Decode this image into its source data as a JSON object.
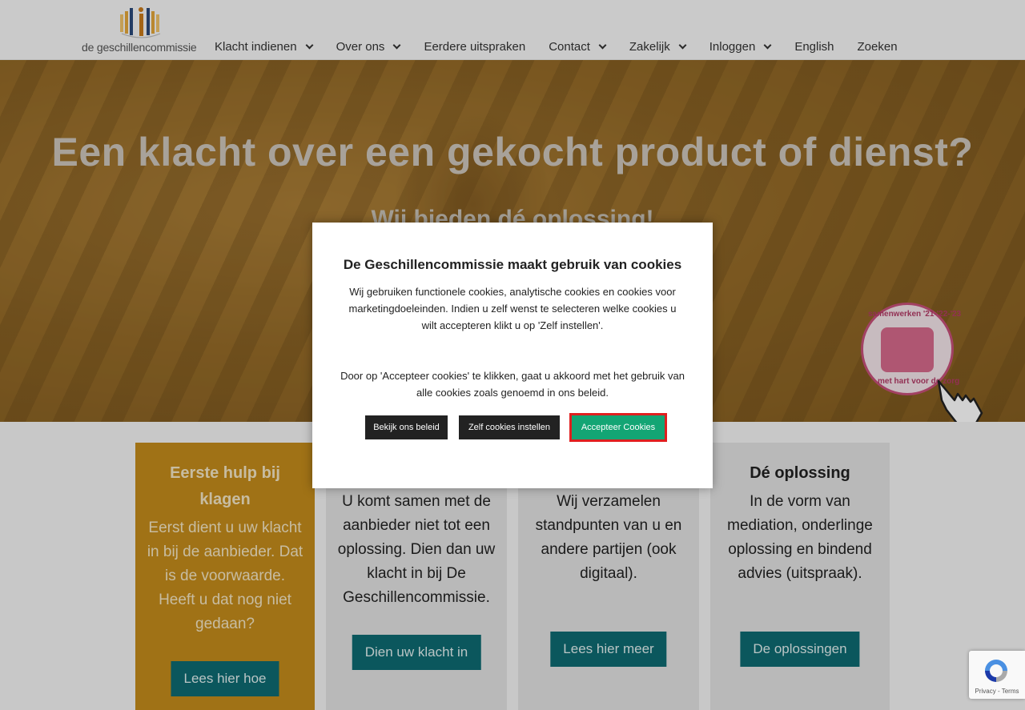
{
  "header": {
    "logo_text": "de geschillencommissie",
    "nav": [
      {
        "label": "Klacht indienen",
        "dropdown": true
      },
      {
        "label": "Over ons",
        "dropdown": true
      },
      {
        "label": "Eerdere uitspraken",
        "dropdown": false
      },
      {
        "label": "Contact",
        "dropdown": true
      },
      {
        "label": "Zakelijk",
        "dropdown": true
      },
      {
        "label": "Inloggen",
        "dropdown": true
      },
      {
        "label": "English",
        "dropdown": false
      },
      {
        "label": "Zoeken",
        "dropdown": false
      }
    ]
  },
  "hero": {
    "title": "Een klacht over een gekocht product of dienst?",
    "subtitle": "Wij bieden dé oplossing!",
    "badge_top": "samenwerken '21-'22-'23",
    "badge_bottom": "met hart voor de zorg"
  },
  "cards": [
    {
      "title": "Eerste hulp bij klagen",
      "text": "Eerst dient u uw klacht in bij de aanbieder. Dat is de voorwaarde. Heeft u dat nog niet gedaan?",
      "button": "Lees hier hoe"
    },
    {
      "title": "",
      "text": "U komt samen met de aanbieder niet tot een oplossing. Dien dan uw klacht in bij De Geschillencommissie.",
      "button": "Dien uw klacht in"
    },
    {
      "title": "",
      "text": "Wij verzamelen standpunten van u en andere partijen (ook digitaal).",
      "button": "Lees hier meer"
    },
    {
      "title": "Dé oplossing",
      "text": "In de vorm van mediation, onderlinge oplossing en bindend advies (uitspraak).",
      "button": "De oplossingen"
    }
  ],
  "cookie_modal": {
    "title": "De Geschillencommissie maakt gebruik van cookies",
    "text1": "Wij gebruiken functionele cookies, analytische cookies en cookies voor marketingdoeleinden. Indien u zelf wenst te selecteren welke cookies u wilt accepteren klikt u op 'Zelf instellen'.",
    "text2": "Door op 'Accepteer cookies' te klikken, gaat u akkoord met het gebruik van alle cookies zoals genoemd in ons beleid.",
    "buttons": {
      "policy": "Bekijk ons beleid",
      "settings": "Zelf cookies instellen",
      "accept": "Accepteer Cookies"
    }
  },
  "recaptcha": {
    "text": "Privacy - Terms"
  },
  "colors": {
    "brand_teal": "#0e6b72",
    "card_gold": "#c48c1c",
    "accept_green": "#13a574",
    "highlight_red": "#e01f1f"
  },
  "icons": [
    "logo-figures-icon",
    "chevron-down-icon",
    "hand-pointer-icon",
    "recaptcha-icon"
  ]
}
